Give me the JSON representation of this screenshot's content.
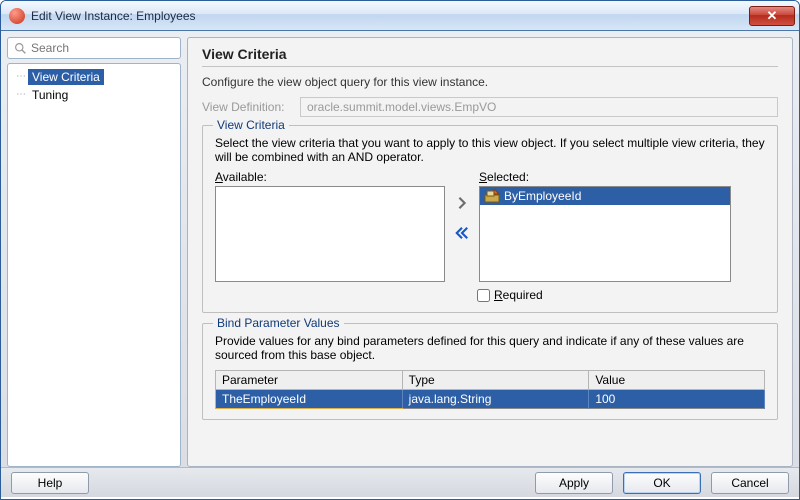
{
  "window": {
    "title": "Edit View Instance: Employees",
    "close_label": "✕"
  },
  "sidebar": {
    "search_placeholder": "Search",
    "items": [
      {
        "label": "View Criteria",
        "selected": true
      },
      {
        "label": "Tuning",
        "selected": false
      }
    ]
  },
  "panel": {
    "title": "View Criteria",
    "description": "Configure the view object query for this view instance.",
    "view_definition_label": "View Definition:",
    "view_definition_value": "oracle.summit.model.views.EmpVO"
  },
  "view_criteria": {
    "legend": "View Criteria",
    "instructions": "Select the view criteria that you want to apply to this view object. If you select multiple view criteria, they will be combined with an AND operator.",
    "available_label": "Available:",
    "selected_label": "Selected:",
    "selected_items": [
      {
        "label": "ByEmployeeId"
      }
    ],
    "required_label": "Required"
  },
  "bind_params": {
    "legend": "Bind Parameter Values",
    "instructions": "Provide values for any bind parameters defined for this query and indicate if any of these values are sourced from this base object.",
    "columns": {
      "param": "Parameter",
      "type": "Type",
      "value": "Value"
    },
    "rows": [
      {
        "param": "TheEmployeeId",
        "type": "java.lang.String",
        "value": "100"
      }
    ]
  },
  "buttons": {
    "help": "Help",
    "apply": "Apply",
    "ok": "OK",
    "cancel": "Cancel"
  }
}
